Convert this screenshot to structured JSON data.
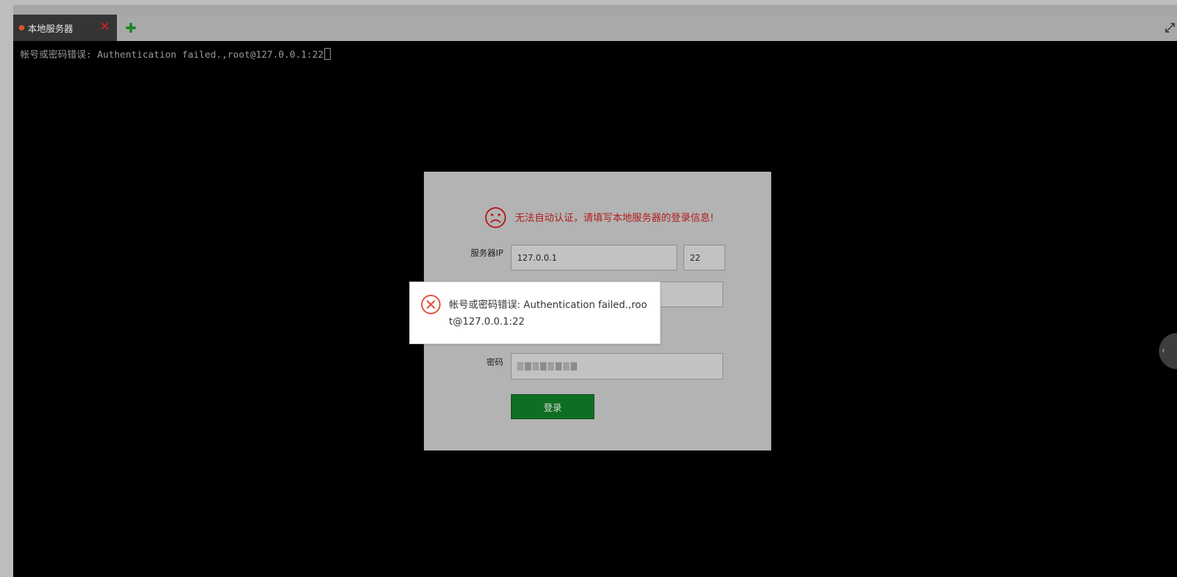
{
  "tabs": [
    {
      "label": "本地服务器",
      "status_color": "#d9522c"
    }
  ],
  "tab_close_label": "✕",
  "tab_add_label": "✚",
  "terminal": {
    "line": "帐号或密码错误: Authentication failed.,root@127.0.0.1:22"
  },
  "login": {
    "warning": "无法自动认证，请填写本地服务器的登录信息!",
    "server_ip_label": "服务器IP",
    "server_ip_value": "127.0.0.1",
    "port_value": "22",
    "password_label": "密码",
    "submit_label": "登录"
  },
  "error_toast": {
    "message": "帐号或密码错误: Authentication failed.,root@127.0.0.1:22"
  },
  "icons": {
    "tab_status": "status-dot-icon",
    "close": "close-icon",
    "add": "plus-icon",
    "expand": "expand-icon",
    "warning": "sad-face-icon",
    "error": "error-circle-icon",
    "side_handle": "chevron-left-icon"
  },
  "colors": {
    "terminal_bg": "#000000",
    "accent_green": "#0e6f22",
    "warning_red": "#b31c1c",
    "error_red": "#e0503a"
  }
}
